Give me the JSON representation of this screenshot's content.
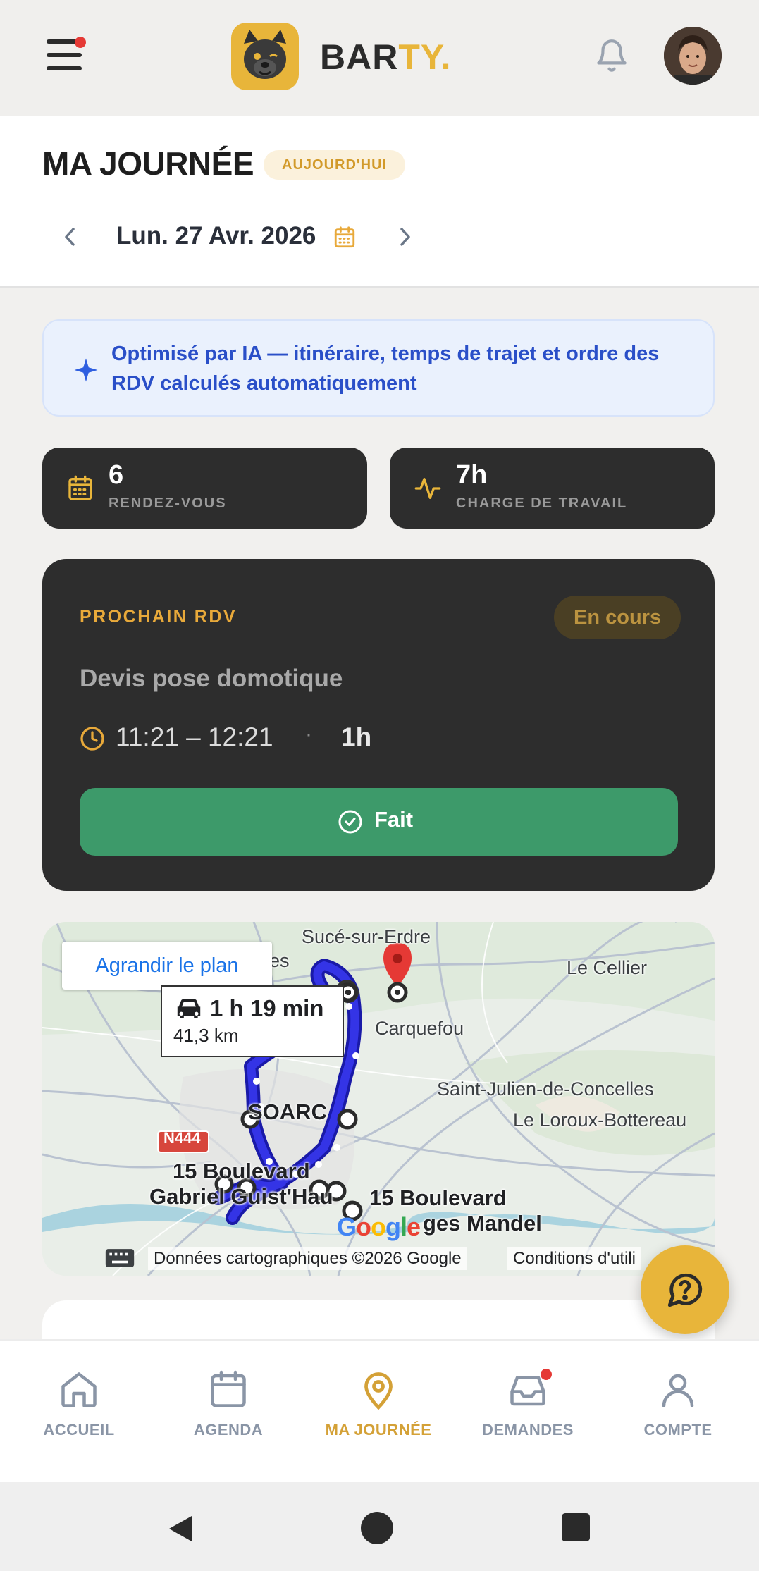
{
  "header": {
    "brand_name_main": "BAR",
    "brand_name_accent": "TY.",
    "menu_icon": "hamburger-menu-icon",
    "notification_icon": "bell-icon",
    "avatar_icon": "user-avatar"
  },
  "page": {
    "title": "MA JOURNÉE",
    "today_badge": "AUJOURD'HUI",
    "date": "Lun. 27 Avr. 2026"
  },
  "ai_banner": {
    "text": "Optimisé par IA — itinéraire, temps de trajet et ordre des RDV calculés automatiquement"
  },
  "stats": [
    {
      "value": "6",
      "label": "RENDEZ-VOUS",
      "icon": "calendar-icon"
    },
    {
      "value": "7h",
      "label": "CHARGE DE TRAVAIL",
      "icon": "activity-icon"
    }
  ],
  "next_appointment": {
    "label": "PROCHAIN RDV",
    "status": "En cours",
    "title": "Devis pose domotique",
    "time": "11:21 – 12:21",
    "separator": "·",
    "duration": "1h",
    "done_button": "Fait"
  },
  "map": {
    "enlarge_button": "Agrandir le plan",
    "route_duration": "1 h 19 min",
    "route_distance": "41,3 km",
    "places": {
      "suce": "Sucé-sur-Erdre",
      "cellier": "Le Cellier",
      "es": "es",
      "carquefou": "Carquefou",
      "saint_julien": "Saint-Julien-de-Concelles",
      "loroux": "Le Loroux-Bottereau",
      "soarc": "SOARC",
      "n444": "N444",
      "guist_line1": "15 Boulevard",
      "guist_line2": "Gabriel Guist'Hau",
      "mandel_line1": "15 Boulevard",
      "mandel_line2": "ges Mandel"
    },
    "attribution": "Données cartographiques ©2026 Google",
    "terms": "Conditions d'utili",
    "google_logo": "Google",
    "colors": {
      "route": "#2222cc",
      "marker": "#e53935"
    }
  },
  "bottom_nav": [
    {
      "label": "ACCUEIL",
      "icon": "home-icon",
      "active": false
    },
    {
      "label": "AGENDA",
      "icon": "calendar-icon",
      "active": false
    },
    {
      "label": "MA JOURNÉE",
      "icon": "location-pin-icon",
      "active": true
    },
    {
      "label": "DEMANDES",
      "icon": "inbox-icon",
      "active": false
    },
    {
      "label": "COMPTE",
      "icon": "user-icon",
      "active": false
    }
  ],
  "colors": {
    "accent": "#e8b53a",
    "dark_card": "#2d2d2d",
    "success": "#3d9a6a",
    "ai_blue": "#2a4fc8"
  }
}
